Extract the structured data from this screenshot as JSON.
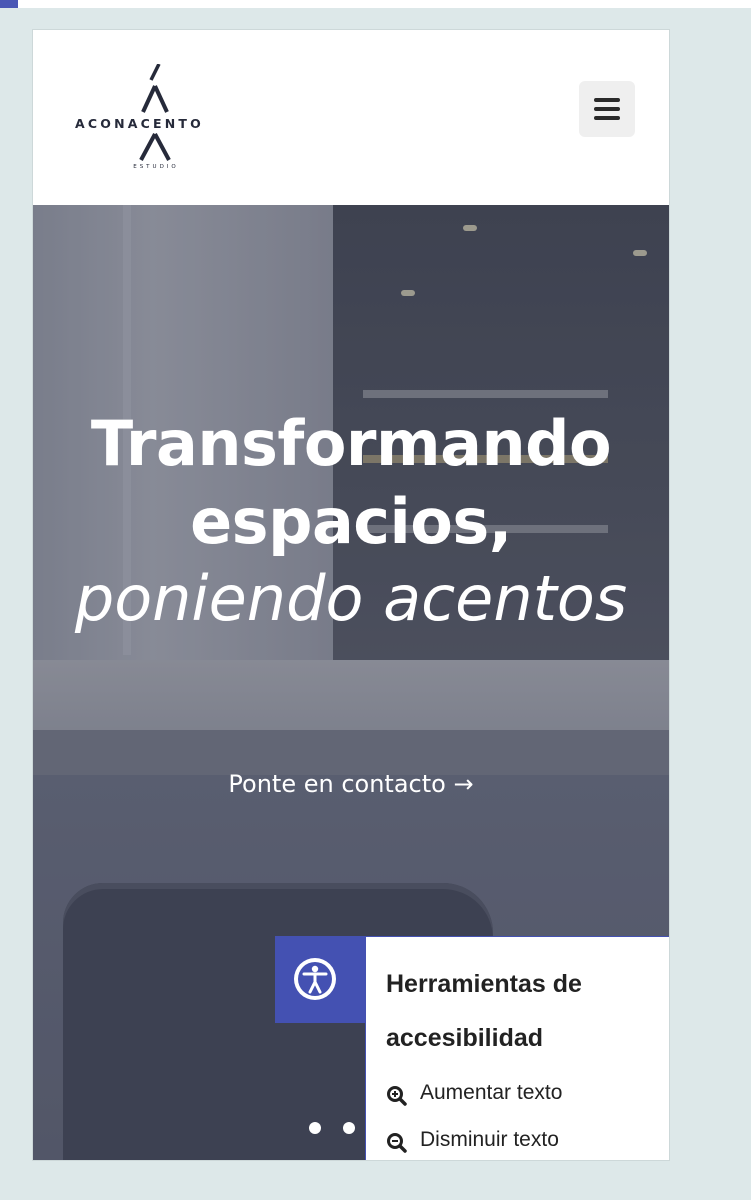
{
  "brand": {
    "name": "ACONACENTO",
    "subtitle": "ESTUDIO",
    "accent_color": "#4451b2",
    "text_color": "#262a3a"
  },
  "header": {
    "menu_icon": "hamburger-menu-icon"
  },
  "hero": {
    "title": "Transformando espacios,",
    "subtitle": "poniendo acentos",
    "cta_label": "Ponte en contacto →",
    "slides_visible_dots": 2
  },
  "accessibility": {
    "title": "Herramientas de accesibilidad",
    "icon": "accessibility-person-icon",
    "items": [
      {
        "label": "Aumentar texto",
        "icon": "zoom-in-icon"
      },
      {
        "label": "Disminuir texto",
        "icon": "zoom-out-icon"
      }
    ]
  }
}
